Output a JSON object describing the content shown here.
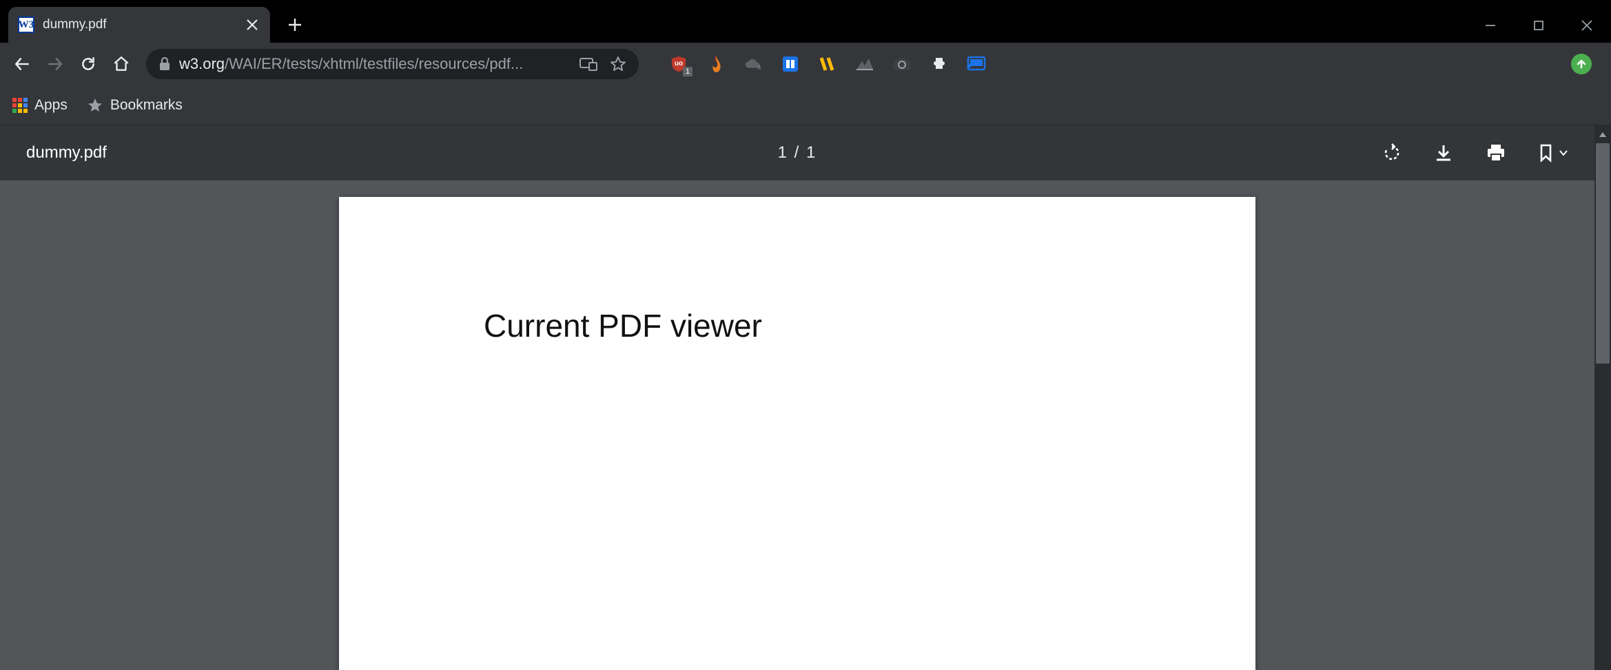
{
  "window": {
    "tab_title": "dummy.pdf",
    "favicon_text": "W3"
  },
  "nav": {
    "url_domain": "w3.org",
    "url_path": "/WAI/ER/tests/xhtml/testfiles/resources/pdf..."
  },
  "extensions": {
    "ublock_badge": "1"
  },
  "bookmarks": {
    "apps_label": "Apps",
    "bookmarks_label": "Bookmarks"
  },
  "pdf": {
    "filename": "dummy.pdf",
    "page_info": "1 / 1",
    "content_heading": "Current PDF viewer"
  }
}
